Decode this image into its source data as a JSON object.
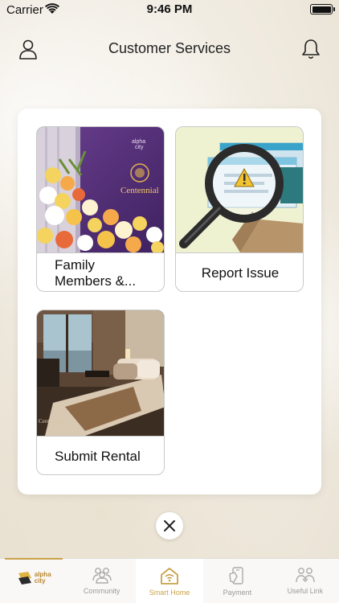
{
  "status_bar": {
    "carrier": "Carrier",
    "time": "9:46 PM"
  },
  "header": {
    "title": "Customer Services"
  },
  "tiles": [
    {
      "label": "Family Members &...",
      "label_line1": "Family",
      "label_line2": "Members &...",
      "image": "flower-event-photo"
    },
    {
      "label": "Report Issue",
      "image": "magnifier-warning-illustration"
    },
    {
      "label": "Submit Rental",
      "image": "bedroom-photo"
    }
  ],
  "photo_text": {
    "brand_line1": "alpha",
    "brand_line2": "city",
    "sign": "Centennial"
  },
  "tab_bar": {
    "logo_line1": "alpha",
    "logo_line2": "city",
    "items": [
      {
        "label": "Community",
        "icon": "community-icon"
      },
      {
        "label": "Smart Home",
        "icon": "smart-home-icon"
      },
      {
        "label": "Payment",
        "icon": "payment-icon"
      },
      {
        "label": "Useful Link",
        "icon": "useful-link-icon"
      }
    ]
  },
  "colors": {
    "accent": "#c9a24a",
    "card": "#ffffff",
    "inactive": "#9a9a9a"
  }
}
